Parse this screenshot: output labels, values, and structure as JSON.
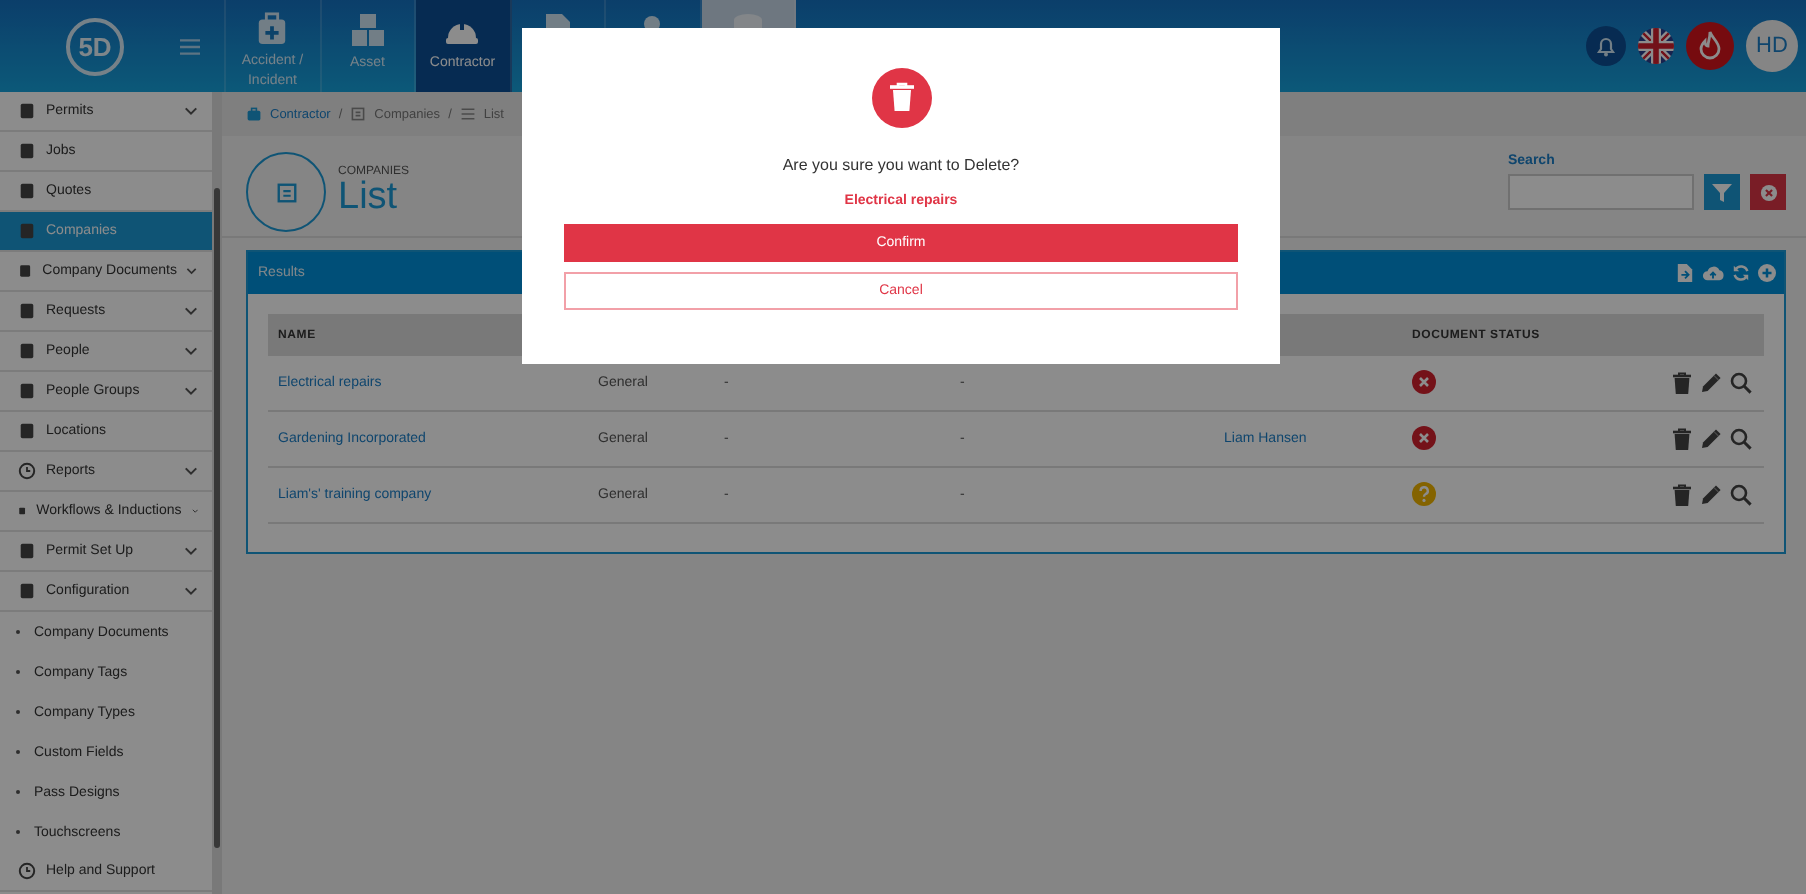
{
  "header": {
    "logo": "5D",
    "nav_tiles": [
      {
        "kind": "incident",
        "label": "Accident / Incident",
        "selected": false
      },
      {
        "kind": "asset",
        "label": "Asset",
        "selected": false
      },
      {
        "kind": "contractor",
        "label": "Contractor",
        "selected": true
      },
      {
        "kind": "permit",
        "selected": false
      },
      {
        "kind": "person",
        "selected": false
      },
      {
        "kind": "stack",
        "selected": false,
        "highlighted": true
      }
    ],
    "avatar": "HD"
  },
  "sidebar": {
    "items": [
      {
        "kind": "permits",
        "label": "Permits",
        "expandable": true,
        "selected": false
      },
      {
        "kind": "jobs",
        "label": "Jobs",
        "expandable": false,
        "selected": false
      },
      {
        "kind": "quotes",
        "label": "Quotes",
        "expandable": false,
        "selected": false
      },
      {
        "kind": "companies",
        "label": "Companies",
        "expandable": false,
        "selected": true
      },
      {
        "kind": "documents",
        "label": "Company Documents",
        "expandable": true,
        "selected": false
      },
      {
        "kind": "requests",
        "label": "Requests",
        "expandable": true,
        "selected": false
      },
      {
        "kind": "people",
        "label": "People",
        "expandable": true,
        "selected": false
      },
      {
        "kind": "groups",
        "label": "People Groups",
        "expandable": true,
        "selected": false
      },
      {
        "kind": "locations",
        "label": "Locations",
        "expandable": false,
        "selected": false
      },
      {
        "kind": "reports",
        "label": "Reports",
        "expandable": true,
        "selected": false
      },
      {
        "kind": "workflows",
        "label": "Workflows & Inductions",
        "expandable": true,
        "selected": false
      },
      {
        "kind": "permitsetup",
        "label": "Permit Set Up",
        "expandable": true,
        "selected": false
      },
      {
        "kind": "configuration",
        "label": "Configuration",
        "expandable": true,
        "expanded": true,
        "selected": false,
        "children": [
          {
            "label": "Company Documents",
            "selected": false
          },
          {
            "label": "Company Tags",
            "selected": false
          },
          {
            "label": "Company Types",
            "selected": false
          },
          {
            "label": "Custom Fields",
            "selected": false
          },
          {
            "label": "Pass Designs",
            "selected": false
          },
          {
            "label": "Touchscreens",
            "selected": false
          }
        ]
      },
      {
        "kind": "help",
        "label": "Help and Support",
        "expandable": false,
        "selected": false
      }
    ]
  },
  "breadcrumb": [
    {
      "kind": "briefcase",
      "label": "Contractor"
    },
    {
      "kind": "building",
      "separator": "/",
      "label": "Companies"
    },
    {
      "kind": "list",
      "separator": "/",
      "label": "List"
    }
  ],
  "page": {
    "overline": "COMPANIES",
    "title": "List"
  },
  "search": {
    "label": "Search"
  },
  "results": {
    "title": "Results",
    "name_header": "NAME",
    "status_header": "DOCUMENT STATUS",
    "rows": [
      {
        "name": "Electrical repairs",
        "type": "General",
        "column_3": "-",
        "column_4": "-",
        "kind": "error"
      },
      {
        "name": "Gardening Incorporated",
        "type": "General",
        "column_3": "-",
        "column_4": "-",
        "column_5": "Liam Hansen",
        "kind": "error"
      },
      {
        "name": "Liam's' training company",
        "type": "General",
        "column_3": "-",
        "column_4": "-",
        "kind": "unknown"
      }
    ]
  },
  "dialog": {
    "question": "Are you sure you want to Delete?",
    "item": "Electrical repairs",
    "confirm": "Confirm",
    "cancel": "Cancel"
  }
}
